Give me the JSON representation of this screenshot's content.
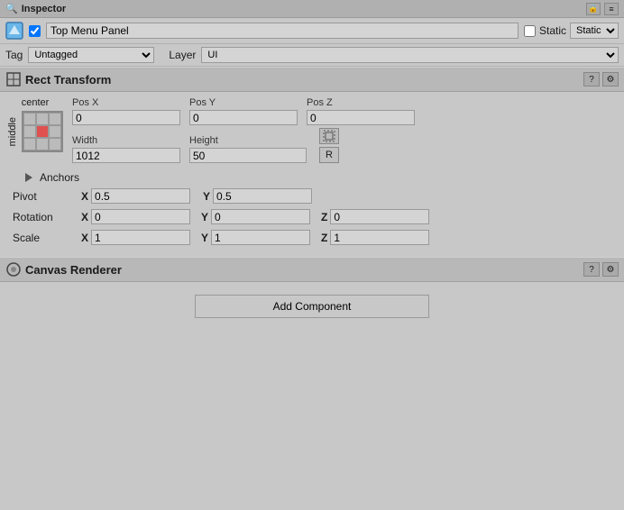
{
  "titleBar": {
    "title": "Inspector",
    "lockIcon": "🔒",
    "menuIcon": "≡"
  },
  "topRow": {
    "checkboxChecked": true,
    "gameObjectName": "Top Menu Panel",
    "staticLabel": "Static",
    "staticChecked": false,
    "dropdownArrow": "▼"
  },
  "tagLayer": {
    "tagLabel": "Tag",
    "tagValue": "Untagged",
    "layerLabel": "Layer",
    "layerValue": "UI"
  },
  "rectTransform": {
    "title": "Rect Transform",
    "centerLabel": "center",
    "middleLabel": "middle",
    "posXLabel": "Pos X",
    "posXValue": "0",
    "posYLabel": "Pos Y",
    "posYValue": "0",
    "posZLabel": "Pos Z",
    "posZValue": "0",
    "widthLabel": "Width",
    "widthValue": "1012",
    "heightLabel": "Height",
    "heightValue": "50",
    "anchorsLabel": "Anchors",
    "pivotLabel": "Pivot",
    "pivotX": "0.5",
    "pivotY": "0.5",
    "rotationLabel": "Rotation",
    "rotationX": "0",
    "rotationY": "0",
    "rotationZ": "0",
    "scaleLabel": "Scale",
    "scaleX": "1",
    "scaleY": "1",
    "scaleZ": "1"
  },
  "canvasRenderer": {
    "title": "Canvas Renderer"
  },
  "addComponent": {
    "label": "Add Component"
  }
}
